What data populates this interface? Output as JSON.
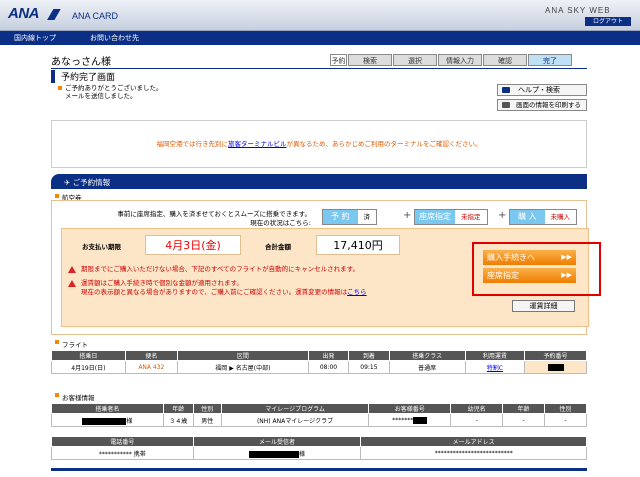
{
  "header": {
    "logo": "ANA",
    "card": "ANA CARD",
    "skyweb": "ANA SKY WEB",
    "logout": "ログアウト",
    "nav": [
      "国内線トップ",
      "お問い合わせ先"
    ]
  },
  "greeting": "あなっさん様",
  "steps": {
    "first": "予約",
    "items": [
      "検索",
      "選択",
      "情報入力",
      "確認",
      "完了"
    ]
  },
  "page_title": "予約完了画面",
  "thanks": [
    "ご予約ありがとうございました。",
    "メールを送信しました。"
  ],
  "help_button": "ヘルプ・検索",
  "print_button": "画面の情報を印刷する",
  "notice": {
    "pre": "福岡空港では行き先別に",
    "link": "旅客ターミナルビル",
    "post": "が異なるため、あらかじめご利用のターミナルをご確認ください。"
  },
  "booking_section": "ご予約情報",
  "tab_label": "航空券",
  "instruction": [
    "事前に座席指定、購入を済ませておくとスムーズに搭乗できます。",
    "現在の状況はこちら:"
  ],
  "stages": [
    {
      "label": "予 約",
      "value": "済"
    },
    {
      "label": "座席指定",
      "value": "未指定"
    },
    {
      "label": "購 入",
      "value": "未購入"
    }
  ],
  "payment": {
    "deadline_label": "お支払い期限",
    "deadline": "4月3日(金)",
    "total_label": "合計金額",
    "total": "17,410円"
  },
  "warnings": [
    "期限までにご購入いただけない場合、下記のすべてのフライトが自動的にキャンセルされます。",
    "運賃額はご購入手続き時で個別な金額が適用されます。",
    "現在の表示額と異なる場合がありますので、ご購入前にご確認ください。運賃変更の情報は",
    "こちら"
  ],
  "buttons": {
    "purchase": "購入手続きへ",
    "seat": "座席指定",
    "fare_detail": "運賃詳細"
  },
  "flight": {
    "title": "フライト",
    "headers": [
      "搭乗日",
      "便名",
      "区間",
      "出発",
      "到着",
      "搭乗クラス",
      "利用運賃",
      "予約番号"
    ],
    "row": {
      "date": "4月19日(日)",
      "flight": "ANA 432",
      "from": "福岡",
      "to": "名古屋(中部)",
      "dep": "08:00",
      "arr": "09:15",
      "class": "普通席",
      "fare": "特割C"
    }
  },
  "passenger": {
    "title": "お客様情報",
    "headers": [
      "搭乗者名",
      "年齢",
      "性別",
      "マイレージプログラム",
      "お客様番号",
      "幼児名",
      "年齢",
      "性別"
    ],
    "row": {
      "name_suffix": "様",
      "age": "３４歳",
      "sex": "男性",
      "program": "(NH) ANAマイレージクラブ",
      "number": "*******",
      "infant": "-",
      "iage": "-",
      "isex": "-"
    }
  },
  "contact": {
    "headers": [
      "電話番号",
      "メール受信者",
      "メールアドレス"
    ],
    "row": {
      "phone": "*********** 携帯",
      "receiver_suffix": "様",
      "email": "**************************"
    }
  },
  "colors": {
    "navy": "#0a2f84",
    "orange": "#ef7d00",
    "highlight": "#e00000"
  }
}
